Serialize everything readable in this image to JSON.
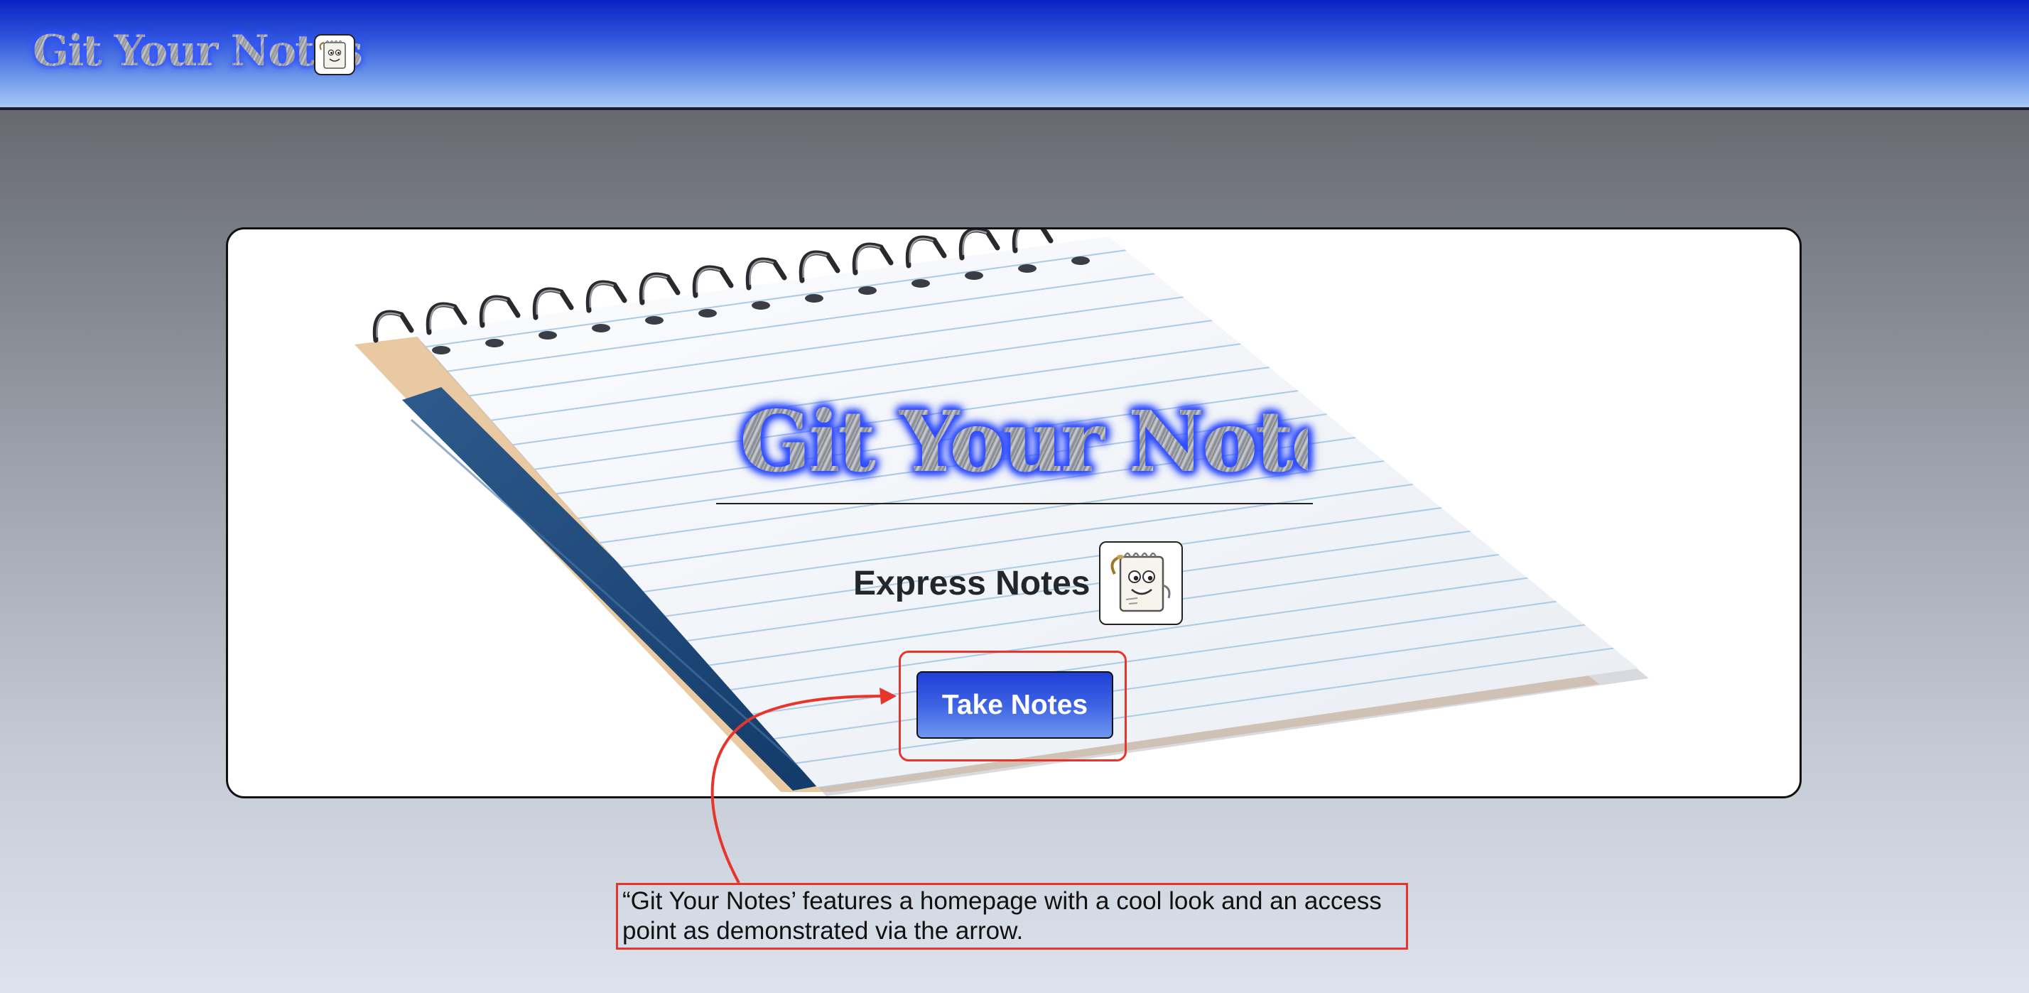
{
  "header": {
    "brand": "Git Your Notes",
    "logo_icon": "notepad-mascot-icon"
  },
  "hero": {
    "title": "Git Your Notes",
    "subtitle": "Express Notes",
    "subtitle_icon": "notepad-mascot-icon",
    "cta_label": "Take Notes"
  },
  "annotation": {
    "caption": "“Git Your Notes’ features a homepage with a cool look and an access point as demonstrated via the arrow.",
    "highlight_color": "#e8352c"
  },
  "colors": {
    "header_top": "#0b22c4",
    "header_bottom": "#a8c9f5",
    "button_top": "#1f3fd6",
    "button_bottom": "#6f97f0",
    "glow": "#2f4dff"
  }
}
